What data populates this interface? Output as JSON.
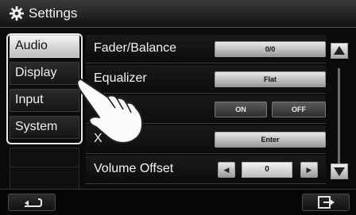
{
  "header": {
    "title": "Settings",
    "icon": "gear-icon"
  },
  "sidebar": {
    "items": [
      {
        "label": "Audio",
        "active": true
      },
      {
        "label": "Display",
        "active": false
      },
      {
        "label": "Input",
        "active": false
      },
      {
        "label": "System",
        "active": false
      }
    ]
  },
  "main": {
    "rows": [
      {
        "label": "Fader/Balance",
        "value": "0/0"
      },
      {
        "label": "Equalizer",
        "value": "Flat"
      },
      {
        "label": "Loudness",
        "visible_label": "ness",
        "on_label": "ON",
        "off_label": "OFF"
      },
      {
        "label": "X'over",
        "visible_label": "X   er",
        "value": "Enter"
      },
      {
        "label": "Volume Offset",
        "value": "0",
        "decrement_icon": "left-arrow-icon",
        "increment_icon": "right-arrow-icon"
      }
    ]
  },
  "scroll": {
    "up_icon": "triangle-up-icon",
    "down_icon": "triangle-down-icon"
  },
  "footer": {
    "back_icon": "back-arrow-icon",
    "exit_icon": "exit-icon"
  },
  "colors": {
    "background": "#0b0b0b",
    "text": "#f4f4f4",
    "active_bg": "#e0e0e0",
    "frame": "#e8e8e8"
  }
}
